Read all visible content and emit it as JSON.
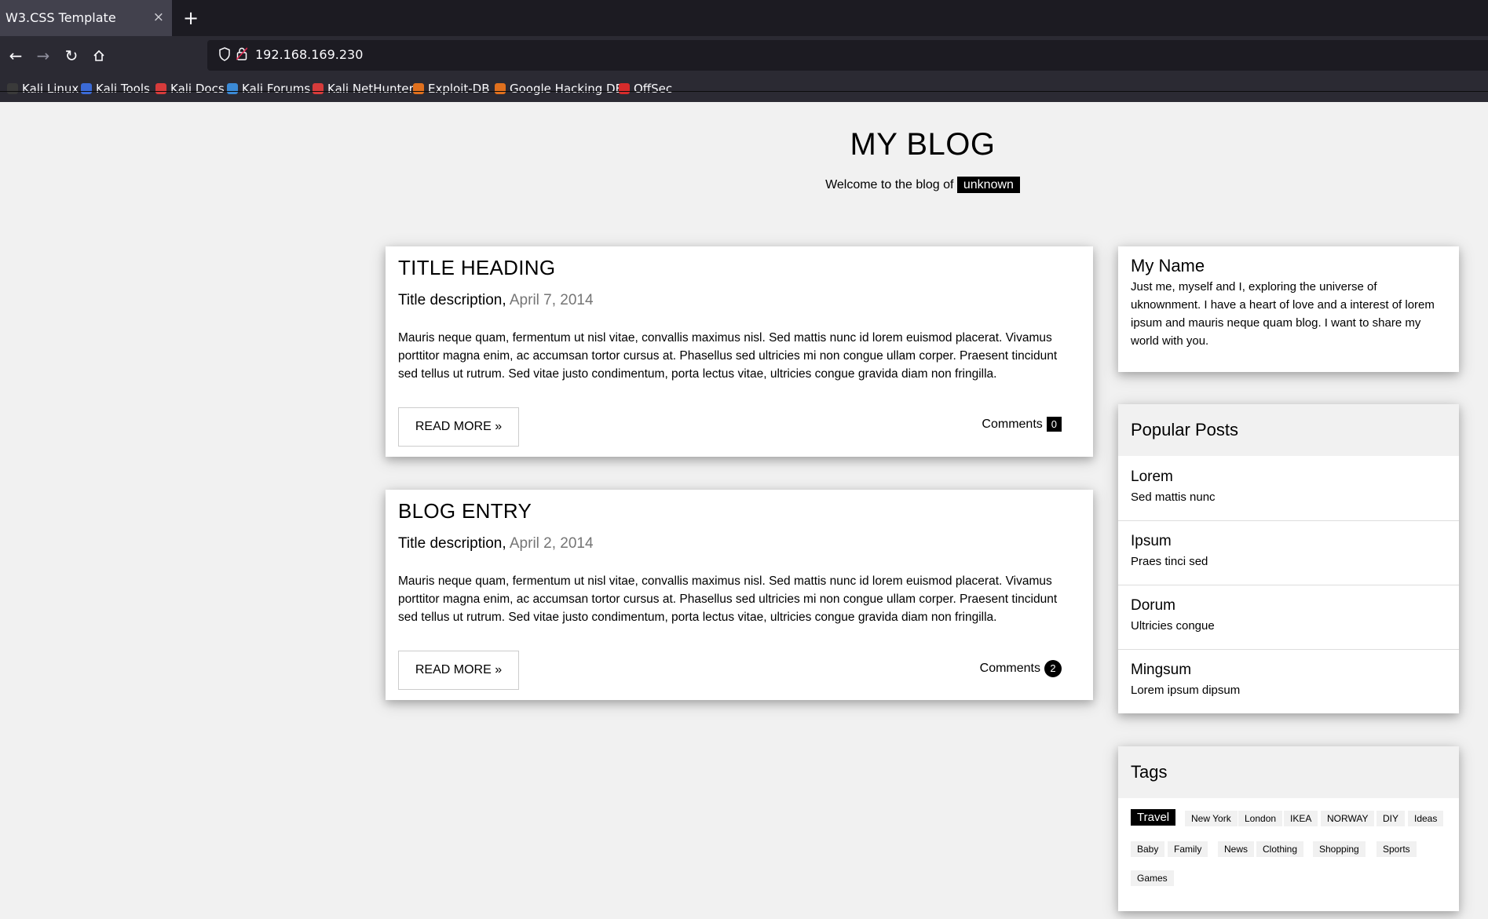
{
  "browser": {
    "tab_title": "W3.CSS Template",
    "tab_close": "×",
    "new_tab": "+",
    "url": "192.168.169.230",
    "bookmarks": [
      {
        "label": "Kali Linux",
        "color": "#3a3a3a"
      },
      {
        "label": "Kali Tools",
        "color": "#3b6ad6"
      },
      {
        "label": "Kali Docs",
        "color": "#d63b3b"
      },
      {
        "label": "Kali Forums",
        "color": "#3b8ad6"
      },
      {
        "label": "Kali NetHunter",
        "color": "#d63b3b"
      },
      {
        "label": "Exploit-DB",
        "color": "#e0701e"
      },
      {
        "label": "Google Hacking DB",
        "color": "#e0701e"
      },
      {
        "label": "OffSec",
        "color": "#d62b2b"
      }
    ]
  },
  "header": {
    "title": "MY BLOG",
    "welcome": "Welcome to the blog of",
    "user": "unknown"
  },
  "entries": [
    {
      "title": "TITLE HEADING",
      "desc": "Title description,",
      "date": "April 7, 2014",
      "body": "Mauris neque quam, fermentum ut nisl vitae, convallis maximus nisl. Sed mattis nunc id lorem euismod placerat. Vivamus porttitor magna enim, ac accumsan tortor cursus at. Phasellus sed ultricies mi non congue ullam corper. Praesent tincidunt sed tellus ut rutrum. Sed vitae justo condimentum, porta lectus vitae, ultricies congue gravida diam non fringilla.",
      "read_more": "READ MORE »",
      "comments_label": "Comments",
      "comments_count": "0"
    },
    {
      "title": "BLOG ENTRY",
      "desc": "Title description,",
      "date": "April 2, 2014",
      "body": "Mauris neque quam, fermentum ut nisl vitae, convallis maximus nisl. Sed mattis nunc id lorem euismod placerat. Vivamus porttitor magna enim, ac accumsan tortor cursus at. Phasellus sed ultricies mi non congue ullam corper. Praesent tincidunt sed tellus ut rutrum. Sed vitae justo condimentum, porta lectus vitae, ultricies congue gravida diam non fringilla.",
      "read_more": "READ MORE »",
      "comments_label": "Comments",
      "comments_count": "2"
    }
  ],
  "about": {
    "title": "My Name",
    "text": "Just me, myself and I, exploring the universe of uknownment. I have a heart of love and a interest of lorem ipsum and mauris neque quam blog. I want to share my world with you."
  },
  "popular": {
    "title": "Popular Posts",
    "posts": [
      {
        "title": "Lorem",
        "sub": "Sed mattis nunc"
      },
      {
        "title": "Ipsum",
        "sub": "Praes tinci sed"
      },
      {
        "title": "Dorum",
        "sub": "Ultricies congue"
      },
      {
        "title": "Mingsum",
        "sub": "Lorem ipsum dipsum"
      }
    ]
  },
  "tags": {
    "title": "Tags",
    "items": [
      "Travel",
      "New York",
      "London",
      "IKEA",
      "NORWAY",
      "DIY",
      "Ideas",
      "Baby",
      "Family",
      "News",
      "Clothing",
      "Shopping",
      "Sports",
      "Games"
    ]
  }
}
